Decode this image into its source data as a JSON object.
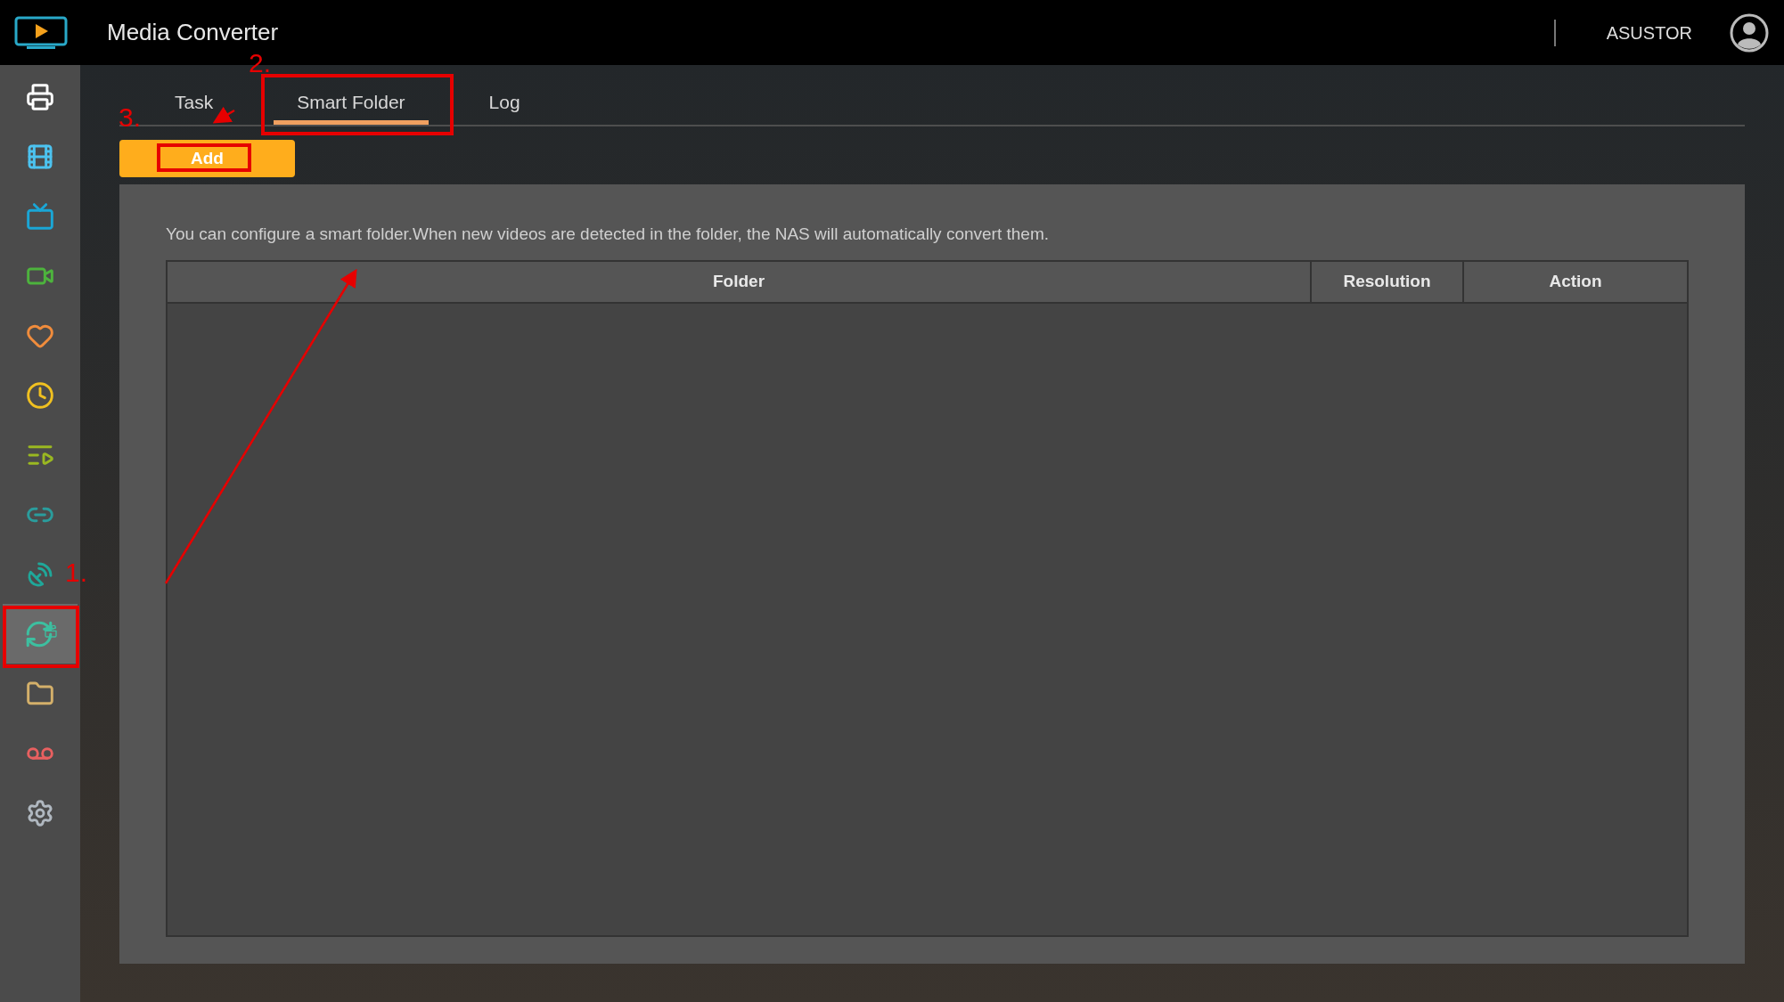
{
  "app": {
    "title": "Media Converter",
    "user": "ASUSTOR"
  },
  "sidebar": {
    "items": [
      {
        "kind": "printer",
        "selected": false
      },
      {
        "kind": "film",
        "selected": false
      },
      {
        "kind": "tv",
        "selected": false
      },
      {
        "kind": "camera",
        "selected": false
      },
      {
        "kind": "heart",
        "selected": false
      },
      {
        "kind": "clock",
        "selected": false
      },
      {
        "kind": "playlist",
        "selected": false
      },
      {
        "kind": "link",
        "selected": false
      },
      {
        "kind": "remote",
        "selected": false
      },
      {
        "kind": "convert",
        "selected": true
      },
      {
        "kind": "folder",
        "selected": false
      },
      {
        "kind": "voicemail",
        "selected": false
      },
      {
        "kind": "settings",
        "selected": false
      }
    ]
  },
  "tabs": [
    {
      "label": "Task",
      "selected": false
    },
    {
      "label": "Smart Folder",
      "selected": true
    },
    {
      "label": "Log",
      "selected": false
    }
  ],
  "add_button": {
    "label": "Add"
  },
  "description": "You can configure a smart folder.When new videos are detected in the folder, the NAS will automatically convert them.",
  "table": {
    "columns": [
      "Folder",
      "Resolution",
      "Action"
    ]
  },
  "annotations": [
    {
      "label": "1."
    },
    {
      "label": "2."
    },
    {
      "label": "3."
    }
  ]
}
